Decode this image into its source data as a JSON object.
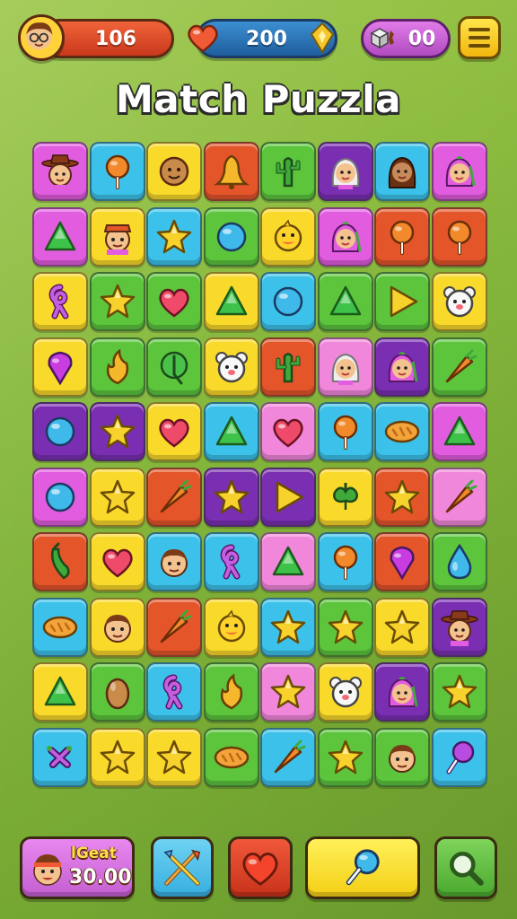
{
  "hud": {
    "score": "106",
    "lives": "200",
    "boosters": "00"
  },
  "title": "Match Puzzla",
  "bottom": {
    "coins_label": "lGeat",
    "coins_value": "30.00"
  },
  "colors": {
    "magenta": "#e25ce0",
    "cyan": "#3cc2ea",
    "yellow": "#f9d92a",
    "orange": "#e4552a",
    "green": "#5cc53c",
    "purple": "#7a2fb3",
    "pink": "#f187da",
    "lime": "#a6d93a"
  },
  "board": {
    "rows": [
      [
        {
          "c": "magenta",
          "i": "cowboy-face"
        },
        {
          "c": "cyan",
          "i": "lollipop"
        },
        {
          "c": "yellow",
          "i": "cookie-face"
        },
        {
          "c": "orange",
          "i": "bell"
        },
        {
          "c": "green",
          "i": "cactus"
        },
        {
          "c": "purple",
          "i": "girl-white-hair"
        },
        {
          "c": "cyan",
          "i": "girl-brown-hair"
        },
        {
          "c": "magenta",
          "i": "girl-pink-hair"
        }
      ],
      [
        {
          "c": "magenta",
          "i": "triangle"
        },
        {
          "c": "yellow",
          "i": "boy-cap"
        },
        {
          "c": "cyan",
          "i": "star"
        },
        {
          "c": "green",
          "i": "ball"
        },
        {
          "c": "yellow",
          "i": "duck"
        },
        {
          "c": "magenta",
          "i": "girl-pink-hair"
        },
        {
          "c": "orange",
          "i": "lollipop"
        },
        {
          "c": "orange",
          "i": "lollipop"
        }
      ],
      [
        {
          "c": "yellow",
          "i": "ribbon"
        },
        {
          "c": "green",
          "i": "star"
        },
        {
          "c": "green",
          "i": "heart"
        },
        {
          "c": "yellow",
          "i": "triangle"
        },
        {
          "c": "cyan",
          "i": "ball"
        },
        {
          "c": "green",
          "i": "triangle"
        },
        {
          "c": "green",
          "i": "play"
        },
        {
          "c": "yellow",
          "i": "bear"
        }
      ],
      [
        {
          "c": "yellow",
          "i": "drop"
        },
        {
          "c": "green",
          "i": "flame"
        },
        {
          "c": "green",
          "i": "leaf"
        },
        {
          "c": "yellow",
          "i": "bear"
        },
        {
          "c": "orange",
          "i": "cactus"
        },
        {
          "c": "pink",
          "i": "girl-white-hair"
        },
        {
          "c": "purple",
          "i": "girl-pink-hair"
        },
        {
          "c": "green",
          "i": "carrot"
        }
      ],
      [
        {
          "c": "purple",
          "i": "ball"
        },
        {
          "c": "purple",
          "i": "star"
        },
        {
          "c": "yellow",
          "i": "heart"
        },
        {
          "c": "cyan",
          "i": "triangle"
        },
        {
          "c": "pink",
          "i": "heart"
        },
        {
          "c": "cyan",
          "i": "lollipop"
        },
        {
          "c": "cyan",
          "i": "bread"
        },
        {
          "c": "magenta",
          "i": "triangle"
        }
      ],
      [
        {
          "c": "magenta",
          "i": "ball"
        },
        {
          "c": "yellow",
          "i": "star"
        },
        {
          "c": "orange",
          "i": "carrot"
        },
        {
          "c": "purple",
          "i": "star"
        },
        {
          "c": "purple",
          "i": "play"
        },
        {
          "c": "yellow",
          "i": "spade"
        },
        {
          "c": "orange",
          "i": "star"
        },
        {
          "c": "pink",
          "i": "carrot"
        }
      ],
      [
        {
          "c": "orange",
          "i": "pepper"
        },
        {
          "c": "yellow",
          "i": "heart"
        },
        {
          "c": "cyan",
          "i": "boy-face"
        },
        {
          "c": "cyan",
          "i": "ribbon"
        },
        {
          "c": "pink",
          "i": "triangle"
        },
        {
          "c": "cyan",
          "i": "lollipop"
        },
        {
          "c": "orange",
          "i": "drop"
        },
        {
          "c": "green",
          "i": "water-drop"
        }
      ],
      [
        {
          "c": "cyan",
          "i": "bread"
        },
        {
          "c": "yellow",
          "i": "boy-face"
        },
        {
          "c": "orange",
          "i": "carrot"
        },
        {
          "c": "yellow",
          "i": "duck"
        },
        {
          "c": "cyan",
          "i": "star"
        },
        {
          "c": "green",
          "i": "star"
        },
        {
          "c": "yellow",
          "i": "star"
        },
        {
          "c": "purple",
          "i": "cowboy-face"
        }
      ],
      [
        {
          "c": "yellow",
          "i": "triangle"
        },
        {
          "c": "green",
          "i": "egg"
        },
        {
          "c": "cyan",
          "i": "ribbon"
        },
        {
          "c": "green",
          "i": "flame"
        },
        {
          "c": "pink",
          "i": "star"
        },
        {
          "c": "yellow",
          "i": "bear"
        },
        {
          "c": "purple",
          "i": "girl-pink-hair"
        },
        {
          "c": "green",
          "i": "star"
        }
      ],
      [
        {
          "c": "cyan",
          "i": "candy"
        },
        {
          "c": "yellow",
          "i": "star"
        },
        {
          "c": "yellow",
          "i": "star"
        },
        {
          "c": "green",
          "i": "bread"
        },
        {
          "c": "cyan",
          "i": "carrot"
        },
        {
          "c": "green",
          "i": "star"
        },
        {
          "c": "green",
          "i": "boy-face"
        },
        {
          "c": "cyan",
          "i": "lollipop-purple"
        }
      ]
    ]
  },
  "icons": {
    "avatar": "boy-glasses-face-icon",
    "lives": "heart-icon",
    "lives_extra": "star-badge-icon",
    "boosters": "dice-icon",
    "menu": "hamburger-menu-icon",
    "swap": "crossed-tools-icon",
    "heart": "heart-icon",
    "hint": "lollipop-icon",
    "search": "magnifier-icon"
  }
}
